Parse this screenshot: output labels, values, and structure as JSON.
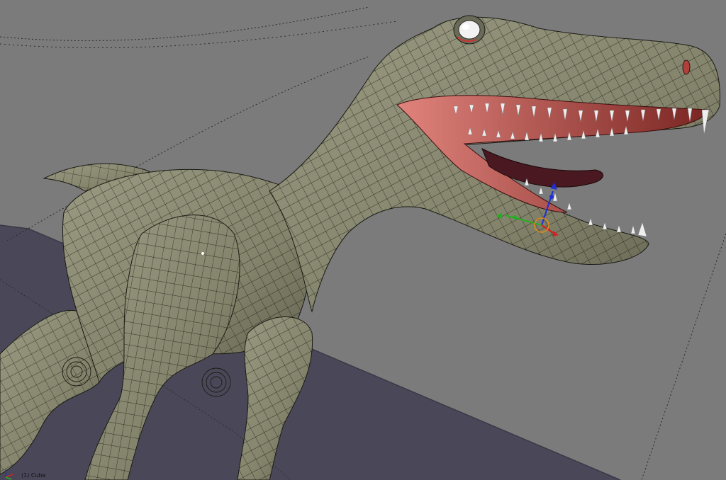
{
  "viewport": {
    "object_label": "(1) Cube"
  },
  "colors": {
    "background": "#7b7b7b",
    "floor": "#4a4858",
    "mesh_skin": "#8a8a72",
    "mesh_shadow": "#5d5d4c",
    "wire": "#1a1a14",
    "mouth": "#a83a36",
    "mouth_light": "#d9716a",
    "teeth": "#eeeeee",
    "eye": "#f2f2f2",
    "gizmo_x": "#d42020",
    "gizmo_y": "#22b022",
    "gizmo_z": "#2030d0",
    "pivot_ring": "#e08a1e"
  },
  "icons": {
    "axis_gizmo": "xyz-axes-icon",
    "transform_gizmo": "transform-manipulator-icon",
    "pivot": "pivot-circle-icon"
  }
}
